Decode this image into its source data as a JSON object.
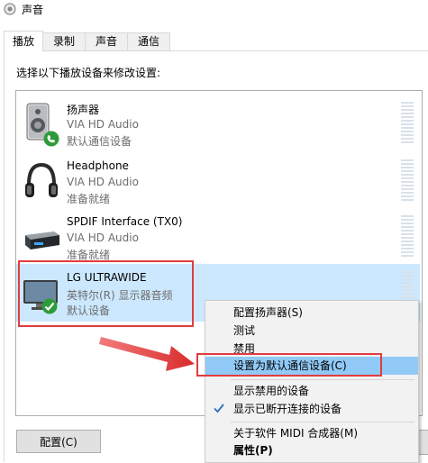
{
  "window": {
    "title": "声音"
  },
  "tabs": [
    {
      "label": "播放",
      "active": true
    },
    {
      "label": "录制",
      "active": false
    },
    {
      "label": "声音",
      "active": false
    },
    {
      "label": "通信",
      "active": false
    }
  ],
  "prompt": "选择以下播放设备来修改设置:",
  "devices": [
    {
      "name": "扬声器",
      "driver": "VIA HD Audio",
      "status": "默认通信设备",
      "icon": "speaker-icon",
      "badge": "phone-badge-icon",
      "selected": false
    },
    {
      "name": "Headphone",
      "driver": "VIA HD Audio",
      "status": "准备就绪",
      "icon": "headphone-icon",
      "selected": false
    },
    {
      "name": "SPDIF Interface (TX0)",
      "driver": "VIA HD Audio",
      "status": "准备就绪",
      "icon": "spdif-device-icon",
      "selected": false
    },
    {
      "name": "LG ULTRAWIDE",
      "driver": "英特尔(R) 显示器音频",
      "status": "默认设备",
      "icon": "monitor-icon",
      "badge": "check-badge-icon",
      "selected": true
    }
  ],
  "buttons": {
    "configure": "配置(C)"
  },
  "context_menu": {
    "items": [
      {
        "label": "配置扬声器(S)"
      },
      {
        "label": "测试"
      },
      {
        "label": "禁用"
      },
      {
        "label": "设置为默认通信设备(C)",
        "highlighted": true
      },
      {
        "label": "显示禁用的设备"
      },
      {
        "label": "显示已断开连接的设备",
        "checked": true
      },
      {
        "label": "关于软件 MIDI 合成器(M)"
      },
      {
        "label": "属性(P)",
        "bold": true
      }
    ]
  },
  "colors": {
    "selection": "#cce8ff",
    "menu_hover": "#91c9f7",
    "annotation_red": "#e33c3c",
    "status_green": "#2e9b3a"
  }
}
